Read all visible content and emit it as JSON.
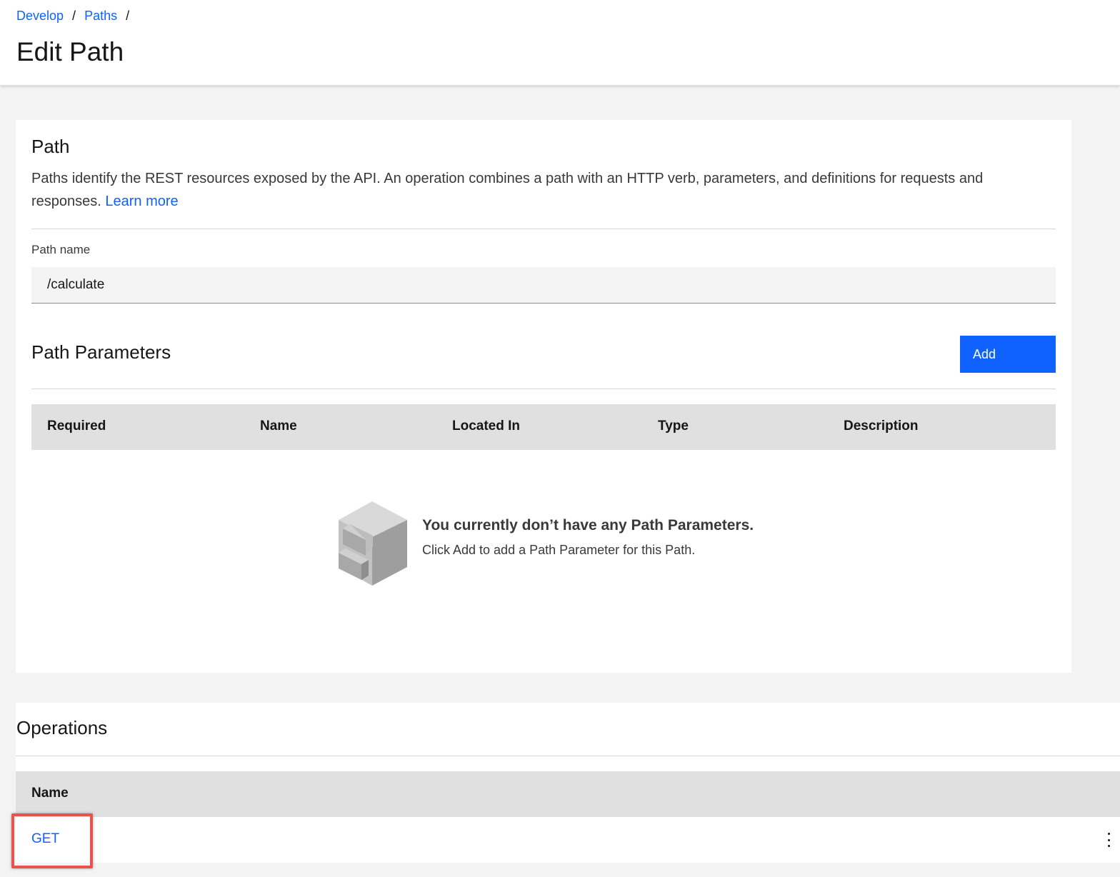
{
  "breadcrumb": {
    "items": [
      {
        "label": "Develop"
      },
      {
        "label": "Paths"
      }
    ],
    "separator": "/"
  },
  "page": {
    "title": "Edit Path"
  },
  "path_section": {
    "title": "Path",
    "description": "Paths identify the REST resources exposed by the API. An operation combines a path with an HTTP verb, parameters, and definitions for requests and responses.",
    "learn_more_label": "Learn more",
    "path_name_label": "Path name",
    "path_name_value": "/calculate"
  },
  "path_parameters": {
    "title": "Path Parameters",
    "add_label": "Add",
    "columns": [
      "Required",
      "Name",
      "Located In",
      "Type",
      "Description"
    ],
    "rows": [],
    "empty_state": {
      "title": "You currently don’t have any Path Parameters.",
      "subtitle": "Click Add to add a Path Parameter for this Path.",
      "icon": "file-cabinet-icon"
    }
  },
  "operations": {
    "title": "Operations",
    "columns": [
      "Name"
    ],
    "rows": [
      {
        "name": "GET"
      }
    ],
    "row_menu_icon": "overflow-menu-icon"
  },
  "colors": {
    "accent": "#0f62fe",
    "highlight": "#e8534e",
    "background": "#f3f3f3",
    "table_header": "#e0e0e0"
  }
}
